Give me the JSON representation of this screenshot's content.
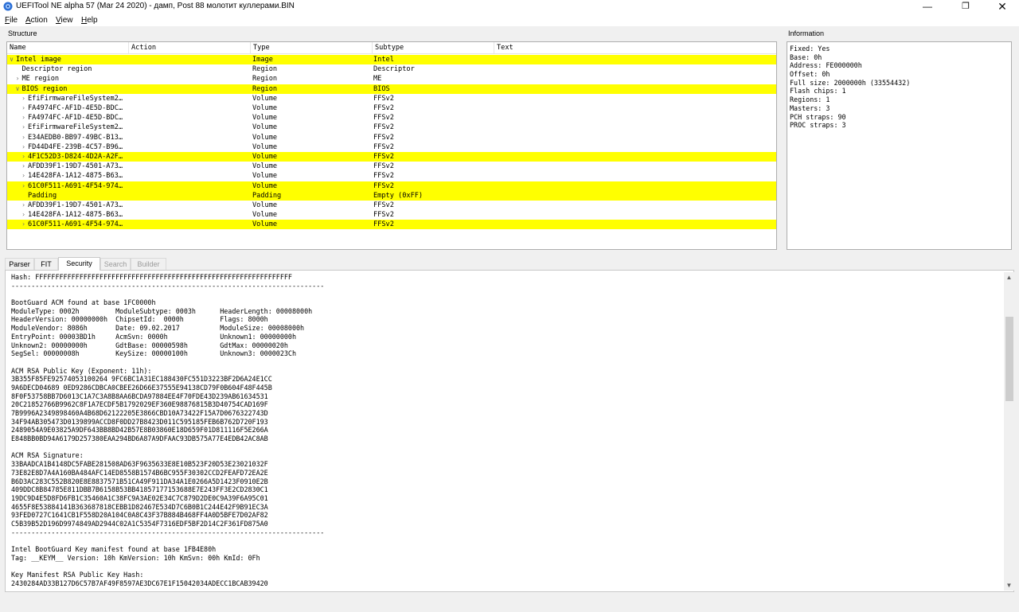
{
  "window": {
    "title": "UEFITool NE alpha 57 (Mar 24 2020) - дамп, Post 88 молотит куллерами.BIN",
    "minimize_glyph": "—",
    "maximize_glyph": "❐",
    "close_glyph": "✕"
  },
  "menu": [
    {
      "key": "F",
      "rest": "ile"
    },
    {
      "key": "A",
      "rest": "ction"
    },
    {
      "key": "V",
      "rest": "iew"
    },
    {
      "key": "H",
      "rest": "elp"
    }
  ],
  "structure": {
    "label": "Structure",
    "columns": [
      "Name",
      "Action",
      "Type",
      "Subtype",
      "Text"
    ],
    "rows": [
      {
        "caret": "∨",
        "name": "Intel image",
        "type": "Image",
        "subtype": "Intel",
        "hl": true,
        "indent": 0
      },
      {
        "caret": "",
        "name": "Descriptor region",
        "type": "Region",
        "subtype": "Descriptor",
        "hl": false,
        "indent": 1
      },
      {
        "caret": "›",
        "name": "ME region",
        "type": "Region",
        "subtype": "ME",
        "hl": false,
        "indent": 1
      },
      {
        "caret": "∨",
        "name": "BIOS region",
        "type": "Region",
        "subtype": "BIOS",
        "hl": true,
        "indent": 1
      },
      {
        "caret": "›",
        "name": "EfiFirmwareFileSystem2…",
        "type": "Volume",
        "subtype": "FFSv2",
        "hl": false,
        "indent": 2
      },
      {
        "caret": "›",
        "name": "FA4974FC-AF1D-4E5D-BDC…",
        "type": "Volume",
        "subtype": "FFSv2",
        "hl": false,
        "indent": 2
      },
      {
        "caret": "›",
        "name": "FA4974FC-AF1D-4E5D-BDC…",
        "type": "Volume",
        "subtype": "FFSv2",
        "hl": false,
        "indent": 2
      },
      {
        "caret": "›",
        "name": "EfiFirmwareFileSystem2…",
        "type": "Volume",
        "subtype": "FFSv2",
        "hl": false,
        "indent": 2
      },
      {
        "caret": "›",
        "name": "E34AEDB0-BB97-49BC-B13…",
        "type": "Volume",
        "subtype": "FFSv2",
        "hl": false,
        "indent": 2
      },
      {
        "caret": "›",
        "name": "FD44D4FE-239B-4C57-B96…",
        "type": "Volume",
        "subtype": "FFSv2",
        "hl": false,
        "indent": 2
      },
      {
        "caret": "›",
        "name": "4F1C52D3-D824-4D2A-A2F…",
        "type": "Volume",
        "subtype": "FFSv2",
        "hl": true,
        "indent": 2
      },
      {
        "caret": "›",
        "name": "AFDD39F1-19D7-4501-A73…",
        "type": "Volume",
        "subtype": "FFSv2",
        "hl": false,
        "indent": 2
      },
      {
        "caret": "›",
        "name": "14E428FA-1A12-4875-B63…",
        "type": "Volume",
        "subtype": "FFSv2",
        "hl": false,
        "indent": 2
      },
      {
        "caret": "›",
        "name": "61C0F511-A691-4F54-974…",
        "type": "Volume",
        "subtype": "FFSv2",
        "hl": true,
        "indent": 2
      },
      {
        "caret": "",
        "name": "Padding",
        "type": "Padding",
        "subtype": "Empty (0xFF)",
        "hl": true,
        "indent": 2
      },
      {
        "caret": "›",
        "name": "AFDD39F1-19D7-4501-A73…",
        "type": "Volume",
        "subtype": "FFSv2",
        "hl": false,
        "indent": 2
      },
      {
        "caret": "›",
        "name": "14E428FA-1A12-4875-B63…",
        "type": "Volume",
        "subtype": "FFSv2",
        "hl": false,
        "indent": 2
      },
      {
        "caret": "›",
        "name": "61C0F511-A691-4F54-974…",
        "type": "Volume",
        "subtype": "FFSv2",
        "hl": true,
        "indent": 2
      }
    ]
  },
  "information": {
    "label": "Information",
    "lines": [
      "Fixed: Yes",
      "Base: 0h",
      "Address: FE000000h",
      "Offset: 0h",
      "Full size: 2000000h (33554432)",
      "Flash chips: 1",
      "Regions: 1",
      "Masters: 3",
      "PCH straps: 90",
      "PROC straps: 3"
    ]
  },
  "tabs": [
    {
      "label": "Parser",
      "active": false,
      "disabled": false
    },
    {
      "label": "FIT",
      "active": false,
      "disabled": false
    },
    {
      "label": "Security",
      "active": true,
      "disabled": false
    },
    {
      "label": "Search",
      "active": false,
      "disabled": true
    },
    {
      "label": "Builder",
      "active": false,
      "disabled": true
    }
  ],
  "security_text": [
    "Hash: FFFFFFFFFFFFFFFFFFFFFFFFFFFFFFFFFFFFFFFFFFFFFFFFFFFFFFFFFFFFFFFF",
    "------------------------------------------------------------------------------",
    "",
    "BootGuard ACM found at base 1FC0000h",
    "ModuleType: 0002h         ModuleSubtype: 0003h      HeaderLength: 00008000h",
    "HeaderVersion: 00000000h  ChipsetId:  0000h         Flags: 8000h",
    "ModuleVendor: 8086h       Date: 09.02.2017          ModuleSize: 00008000h",
    "EntryPoint: 00003BD1h     AcmSvn: 0000h             Unknown1: 00000000h",
    "Unknown2: 00000000h       GdtBase: 00000598h        GdtMax: 00000020h",
    "SegSel: 00000008h         KeySize: 00000100h        Unknown3: 0000023Ch",
    "",
    "ACM RSA Public Key (Exponent: 11h):",
    "3B355F85FE92574053100264 9FC6BC1A31EC188430FC551D3223BF2D6A24E1CC",
    "9A6DECD04689 0ED9286CDBCA0CBEE26D66E37555E94138CD79F0B604F48F445B",
    "8F0F53758BB7D6013C1A7C3A8B8AA6BCDA97884EE4F70FDE43D239AB61634531",
    "20C21852766B9962C8F1A7ECDF5B1792029EF360E98876815B3D40754CAD169F",
    "7B9996A2349898460A4B68D62122205E3866CBD10A73422F15A7D0676322743D",
    "34F94AB305473D0139899ACCD8F0DD27B8423D011C595185FEB6B762D720F193",
    "2489054A9E03825A9DF643BB8BD42B57E8B03860E18D659F01D811116F5E266A",
    "E848BB0BD94A6179D257380EAA294BD6A87A9DFAAC93DB575A77E4EDB42AC8AB",
    "",
    "ACM RSA Signature:",
    "33BAADCA1B4148DC5FABE281508AD63F9635633E8E10B523F20D53E23021032F",
    "73E82E8D7A4A160BA484AFC14ED8558B1574B6BC955F30302CCD2FEAFD72EA2E",
    "B6D3AC283C552B820E8E8837571B51CA49F911DA34A1E0266A5D1423F0910E2B",
    "409DDC8B84785E811DBB7B6158B53BB41857177153688E7E243FF3E2CD2830C1",
    "19DC9D4E5D8FD6FB1C35460A1C38FC9A3AE02E34C7C879D2DE0C9A39F6A95C01",
    "4655F8E53884141B363687818CEBB1D82467E534D7C6B0B1C244E42F9B91EC3A",
    "93FED0727C1641CB1F558D20A104C0A8C43F37B884B468FF4A0D5BFE7D02AF82",
    "C5B39B52D196D9974849AD2944C02A1C5354F7316EDF5BF2D14C2F361FD875A0",
    "------------------------------------------------------------------------------",
    "",
    "Intel BootGuard Key manifest found at base 1FB4E80h",
    "Tag: __KEYM__ Version: 10h KmVersion: 10h KmSvn: 00h KmId: 0Fh",
    "",
    "Key Manifest RSA Public Key Hash:",
    "2430284AD33B127D6C57B7AF49F8597AE3DC67E1F15042034ADECC1BCAB39420"
  ],
  "scrollbar": {
    "up_glyph": "▲",
    "down_glyph": "▼"
  }
}
